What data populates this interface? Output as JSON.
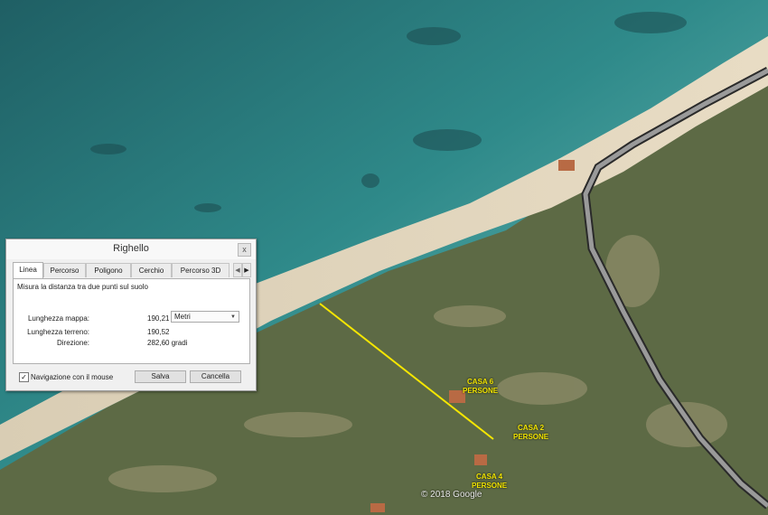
{
  "dialog": {
    "title": "Righello",
    "close_glyph": "x",
    "tabs": [
      "Linea",
      "Percorso",
      "Poligono",
      "Cerchio",
      "Percorso 3D"
    ],
    "active_tab": "Linea",
    "description": "Misura la distanza tra due punti sul suolo",
    "map_length_label": "Lunghezza mappa:",
    "map_length_value": "190,21",
    "unit_select": "Metri",
    "ground_length_label": "Lunghezza terreno:",
    "ground_length_value": "190,52",
    "heading_label": "Direzione:",
    "heading_value": "282,60 gradi",
    "mouse_nav_checked": true,
    "mouse_nav_label": "Navigazione con il mouse",
    "save_label": "Salva",
    "cancel_label": "Cancella"
  },
  "map": {
    "labels": [
      {
        "line1": "CASA 6",
        "line2": "PERSONE"
      },
      {
        "line1": "CASA 2",
        "line2": "PERSONE"
      },
      {
        "line1": "CASA 4",
        "line2": "PERSONE"
      }
    ],
    "copyright": "© 2018 Google",
    "measure_line_color": "#f5e600"
  }
}
